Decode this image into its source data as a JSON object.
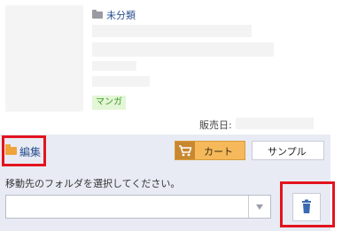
{
  "product": {
    "category_label": "未分類",
    "genre_tag": "マンガ",
    "release_date_label": "販売日:"
  },
  "actions": {
    "edit_label": "編集",
    "cart_label": "カート",
    "sample_label": "サンプル"
  },
  "folder_move": {
    "instruction": "移動先のフォルダを選択してください。",
    "selected_value": ""
  },
  "colors": {
    "panel_bg": "#e8ebf4",
    "cart_orange": "#f5b95b",
    "highlight_red": "#e3141e",
    "tag_green": "#3e9a2a"
  }
}
